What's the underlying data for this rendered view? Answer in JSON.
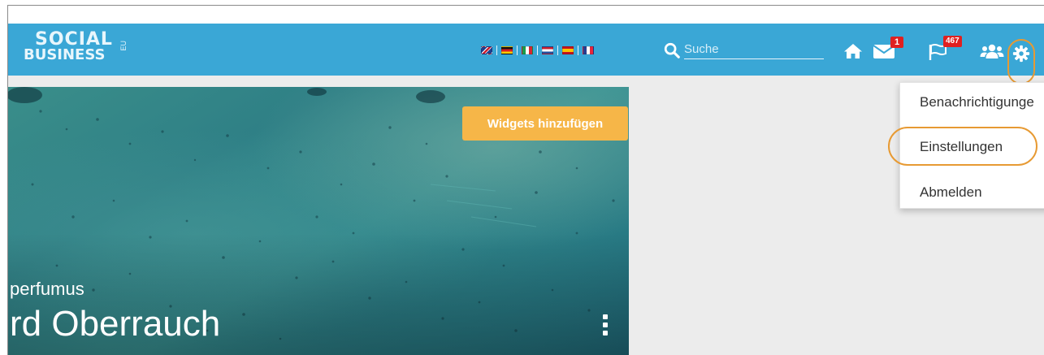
{
  "header": {
    "logo": {
      "line1": "SOCIAL",
      "line2": "BUSINESS",
      "side": "EU"
    },
    "colors": {
      "bar": "#3aa7d6",
      "highlight": "#e79a33",
      "badge": "#e02020"
    },
    "languages": [
      {
        "code": "en",
        "icon": "uk-flag-icon"
      },
      {
        "code": "de",
        "icon": "germany-flag-icon"
      },
      {
        "code": "it",
        "icon": "italy-flag-icon"
      },
      {
        "code": "nl",
        "icon": "netherlands-flag-icon"
      },
      {
        "code": "es",
        "icon": "spain-flag-icon"
      },
      {
        "code": "fr",
        "icon": "france-flag-icon"
      }
    ],
    "search": {
      "placeholder": "Suche"
    },
    "icons": {
      "home": "home-icon",
      "messages": "envelope-icon",
      "notifications": "flag-icon",
      "groups": "users-icon",
      "settings": "gear-icon"
    },
    "badges": {
      "messages": "1",
      "notifications": "467"
    }
  },
  "hero": {
    "widgets_button": "Widgets hinzufügen",
    "subtitle": "perfumus",
    "name": "rd Oberrauch"
  },
  "dropdown": {
    "items": [
      {
        "label": "Benachrichtigunge"
      },
      {
        "label": "Einstellungen"
      },
      {
        "label": "Abmelden"
      }
    ]
  }
}
